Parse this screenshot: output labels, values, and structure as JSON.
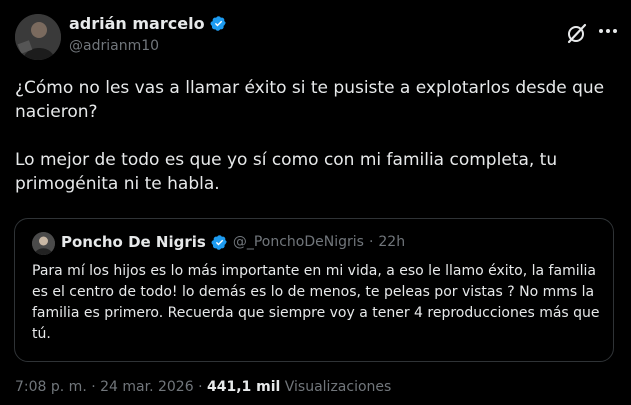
{
  "author": {
    "name": "adrián marcelo",
    "handle": "@adrianm10"
  },
  "tweet": {
    "paragraph1": "¿Cómo no les vas a llamar éxito si te pusiste a explotarlos desde que nacieron?",
    "paragraph2": "Lo mejor de todo es que yo sí como con mi familia completa, tu primogénita ni te habla."
  },
  "quote": {
    "name": "Poncho De Nigris",
    "handle": "@_PonchoDeNigris",
    "separator": "·",
    "time": "22h",
    "text": "Para mí los hijos es lo más importante en mi vida, a eso le llamo éxito, la familia es el centro de todo! lo demás es lo de menos, te peleas por vistas ? No mms la familia es primero. Recuerda que siempre voy a tener 4 reproducciones más que tú."
  },
  "meta": {
    "time": "7:08 p. m.",
    "sep1": "·",
    "date": "24 mar. 2026",
    "sep2": "·",
    "views_count": "441,1 mil",
    "views_label": "Visualizaciones"
  },
  "icons": {
    "verified": "verified-badge-icon",
    "grok": "grok-icon",
    "more": "more-icon"
  },
  "colors": {
    "background": "#000000",
    "text": "#e7e9ea",
    "secondary": "#71767b",
    "verified": "#1d9bf0",
    "border": "#2f3336"
  }
}
